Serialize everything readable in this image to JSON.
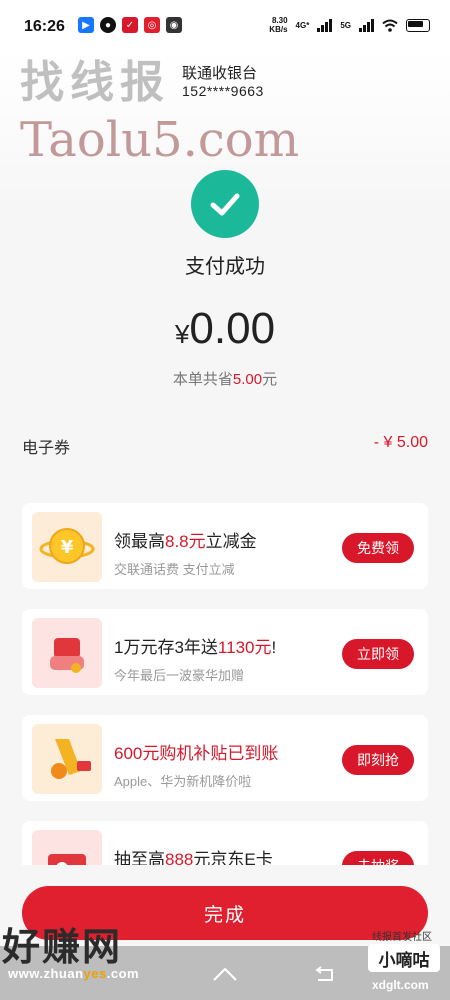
{
  "status_bar": {
    "time": "16:26",
    "net_speed_value": "8.30",
    "net_speed_unit": "KB/s",
    "network1": "4G*",
    "network2": "5G"
  },
  "merchant": {
    "name": "联通收银台",
    "phone": "152****9663"
  },
  "result": {
    "status_text": "支付成功",
    "currency": "¥",
    "amount": "0.00",
    "saved_prefix": "本单共省",
    "saved_amount": "5.00",
    "saved_suffix": "元"
  },
  "coupon": {
    "label": "电子券",
    "value": "- ¥ 5.00"
  },
  "offers": [
    {
      "title_a": "领最高",
      "title_b": "8.8元",
      "title_c": "立减金",
      "subtitle": "交联通话费 支付立减",
      "button": "免费领"
    },
    {
      "title_a": "1万元存3年送",
      "title_b": "1130元",
      "title_c": "!",
      "subtitle": "今年最后一波豪华加赠",
      "button": "立即领"
    },
    {
      "title": "600元购机补贴已到账",
      "subtitle": "Apple、华为新机降价啦",
      "button": "即刻抢"
    },
    {
      "title_a": "抽至高",
      "title_b": "888",
      "title_c": "元京东E卡",
      "button": "去抽奖"
    }
  ],
  "done_label": "完成",
  "watermarks": {
    "top": "找线报",
    "site": "Taolu5.com",
    "bottom": "好赚网",
    "bottom_url_a": "www.zhuan",
    "bottom_url_b": "yes",
    "bottom_url_c": ".com",
    "right_tag": "线报首发社区",
    "right_box": "小嘀咕",
    "right_url": "xdglt.com"
  },
  "colors": {
    "accent": "#d8182a",
    "success": "#1cb89a"
  },
  "icons": [
    "check-icon",
    "home-icon",
    "back-icon",
    "wifi-icon",
    "battery-icon"
  ]
}
